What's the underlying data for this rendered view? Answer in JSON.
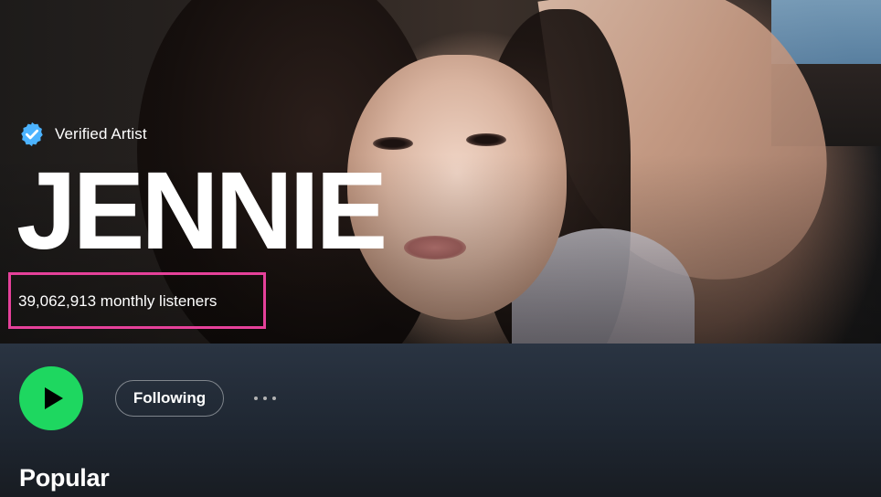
{
  "artist": {
    "verified_label": "Verified Artist",
    "name": "JENNIE",
    "monthly_listeners": "39,062,913 monthly listeners"
  },
  "actions": {
    "play_icon": "play-icon",
    "following_label": "Following",
    "more_icon": "more-options-icon"
  },
  "sections": {
    "popular_title": "Popular"
  },
  "colors": {
    "accent_green": "#1ed760",
    "verified_blue": "#4cb3ff",
    "highlight_pink": "#e5419a"
  }
}
